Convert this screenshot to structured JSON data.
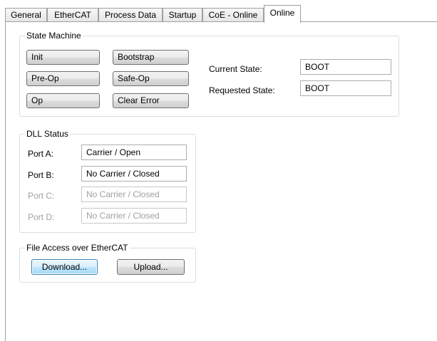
{
  "tabs": [
    {
      "label": "General",
      "active": false
    },
    {
      "label": "EtherCAT",
      "active": false
    },
    {
      "label": "Process Data",
      "active": false
    },
    {
      "label": "Startup",
      "active": false
    },
    {
      "label": "CoE - Online",
      "active": false
    },
    {
      "label": "Online",
      "active": true
    }
  ],
  "state_machine": {
    "title": "State Machine",
    "buttons": {
      "init": "Init",
      "bootstrap": "Bootstrap",
      "preop": "Pre-Op",
      "safeop": "Safe-Op",
      "op": "Op",
      "clear_error": "Clear Error"
    },
    "current_state_label": "Current State:",
    "current_state_value": "BOOT",
    "requested_state_label": "Requested State:",
    "requested_state_value": "BOOT"
  },
  "dll_status": {
    "title": "DLL Status",
    "ports": [
      {
        "label": "Port A:",
        "value": "Carrier / Open",
        "enabled": true
      },
      {
        "label": "Port B:",
        "value": "No Carrier / Closed",
        "enabled": true
      },
      {
        "label": "Port C:",
        "value": "No Carrier / Closed",
        "enabled": false
      },
      {
        "label": "Port D:",
        "value": "No Carrier / Closed",
        "enabled": false
      }
    ]
  },
  "file_access": {
    "title": "File Access over EtherCAT",
    "download_label": "Download...",
    "upload_label": "Upload..."
  }
}
